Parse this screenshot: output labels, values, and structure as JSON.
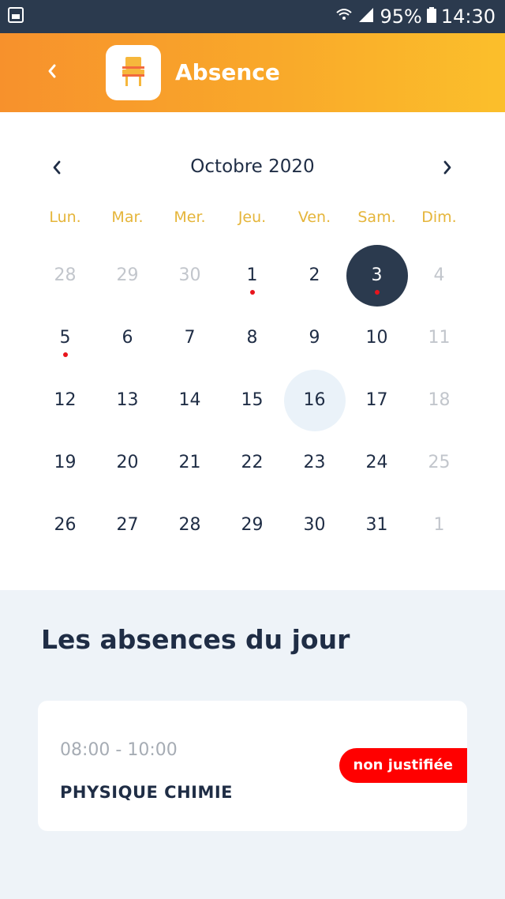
{
  "status_bar": {
    "battery": "95%",
    "time": "14:30"
  },
  "header": {
    "title": "Absence"
  },
  "calendar": {
    "month_label": "Octobre 2020",
    "weekdays": [
      "Lun.",
      "Mar.",
      "Mer.",
      "Jeu.",
      "Ven.",
      "Sam.",
      "Dim."
    ],
    "days": [
      {
        "n": "28",
        "other": true
      },
      {
        "n": "29",
        "other": true
      },
      {
        "n": "30",
        "other": true
      },
      {
        "n": "1",
        "dot": true
      },
      {
        "n": "2"
      },
      {
        "n": "3",
        "selected": true,
        "dot": true
      },
      {
        "n": "4",
        "other": true
      },
      {
        "n": "5",
        "dot": true
      },
      {
        "n": "6"
      },
      {
        "n": "7"
      },
      {
        "n": "8"
      },
      {
        "n": "9"
      },
      {
        "n": "10"
      },
      {
        "n": "11",
        "other": true
      },
      {
        "n": "12"
      },
      {
        "n": "13"
      },
      {
        "n": "14"
      },
      {
        "n": "15"
      },
      {
        "n": "16",
        "today": true
      },
      {
        "n": "17"
      },
      {
        "n": "18",
        "other": true
      },
      {
        "n": "19"
      },
      {
        "n": "20"
      },
      {
        "n": "21"
      },
      {
        "n": "22"
      },
      {
        "n": "23"
      },
      {
        "n": "24"
      },
      {
        "n": "25",
        "other": true
      },
      {
        "n": "26"
      },
      {
        "n": "27"
      },
      {
        "n": "28"
      },
      {
        "n": "29"
      },
      {
        "n": "30"
      },
      {
        "n": "31"
      },
      {
        "n": "1",
        "other": true
      }
    ]
  },
  "absences": {
    "title": "Les absences du jour",
    "items": [
      {
        "time": "08:00 - 10:00",
        "subject": "PHYSIQUE CHIMIE",
        "status": "non justifiée"
      }
    ]
  },
  "colors": {
    "accent_start": "#f7912c",
    "accent_end": "#fbbf2b",
    "selected": "#2b3a4e",
    "weekday": "#e5b53a",
    "badge": "#ff0000"
  }
}
